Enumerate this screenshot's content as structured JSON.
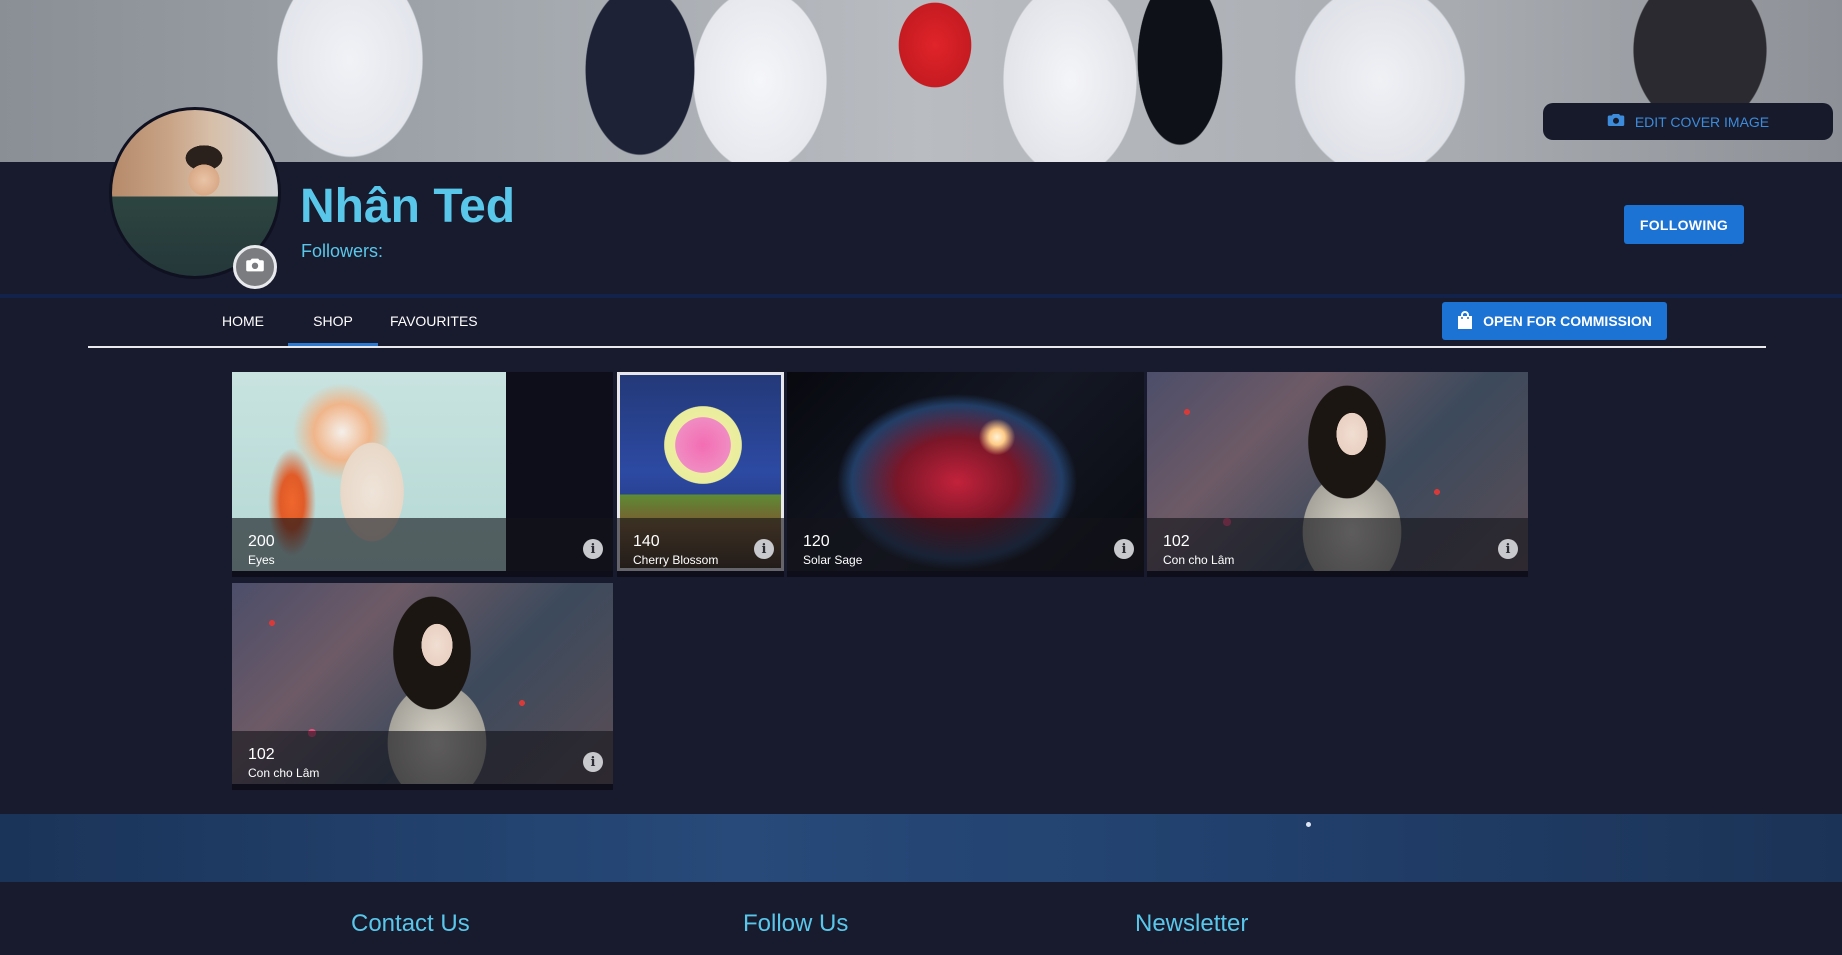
{
  "cover": {
    "edit_label": "EDIT COVER IMAGE",
    "icon": "camera-icon"
  },
  "profile": {
    "name": "Nhân Ted",
    "followers_label": "Followers:",
    "following_button": "FOLLOWING",
    "avatar_icon": "camera-icon"
  },
  "tabs": [
    {
      "label": "HOME",
      "active": false
    },
    {
      "label": "SHOP",
      "active": true
    },
    {
      "label": "FAVOURITES",
      "active": false
    }
  ],
  "commission_button": {
    "label": "OPEN FOR COMMISSION",
    "icon": "shopping-bag-icon"
  },
  "gallery": [
    {
      "price": "200",
      "title": "Eyes"
    },
    {
      "price": "140",
      "title": "Cherry Blossom"
    },
    {
      "price": "120",
      "title": "Solar Sage"
    },
    {
      "price": "102",
      "title": "Con cho Lâm"
    },
    {
      "price": "102",
      "title": "Con cho Lâm"
    }
  ],
  "footer": {
    "contact": "Contact Us",
    "follow": "Follow Us",
    "newsletter": "Newsletter"
  },
  "colors": {
    "background": "#181a2e",
    "accent": "#59c7ea",
    "button": "#1c73d4"
  }
}
